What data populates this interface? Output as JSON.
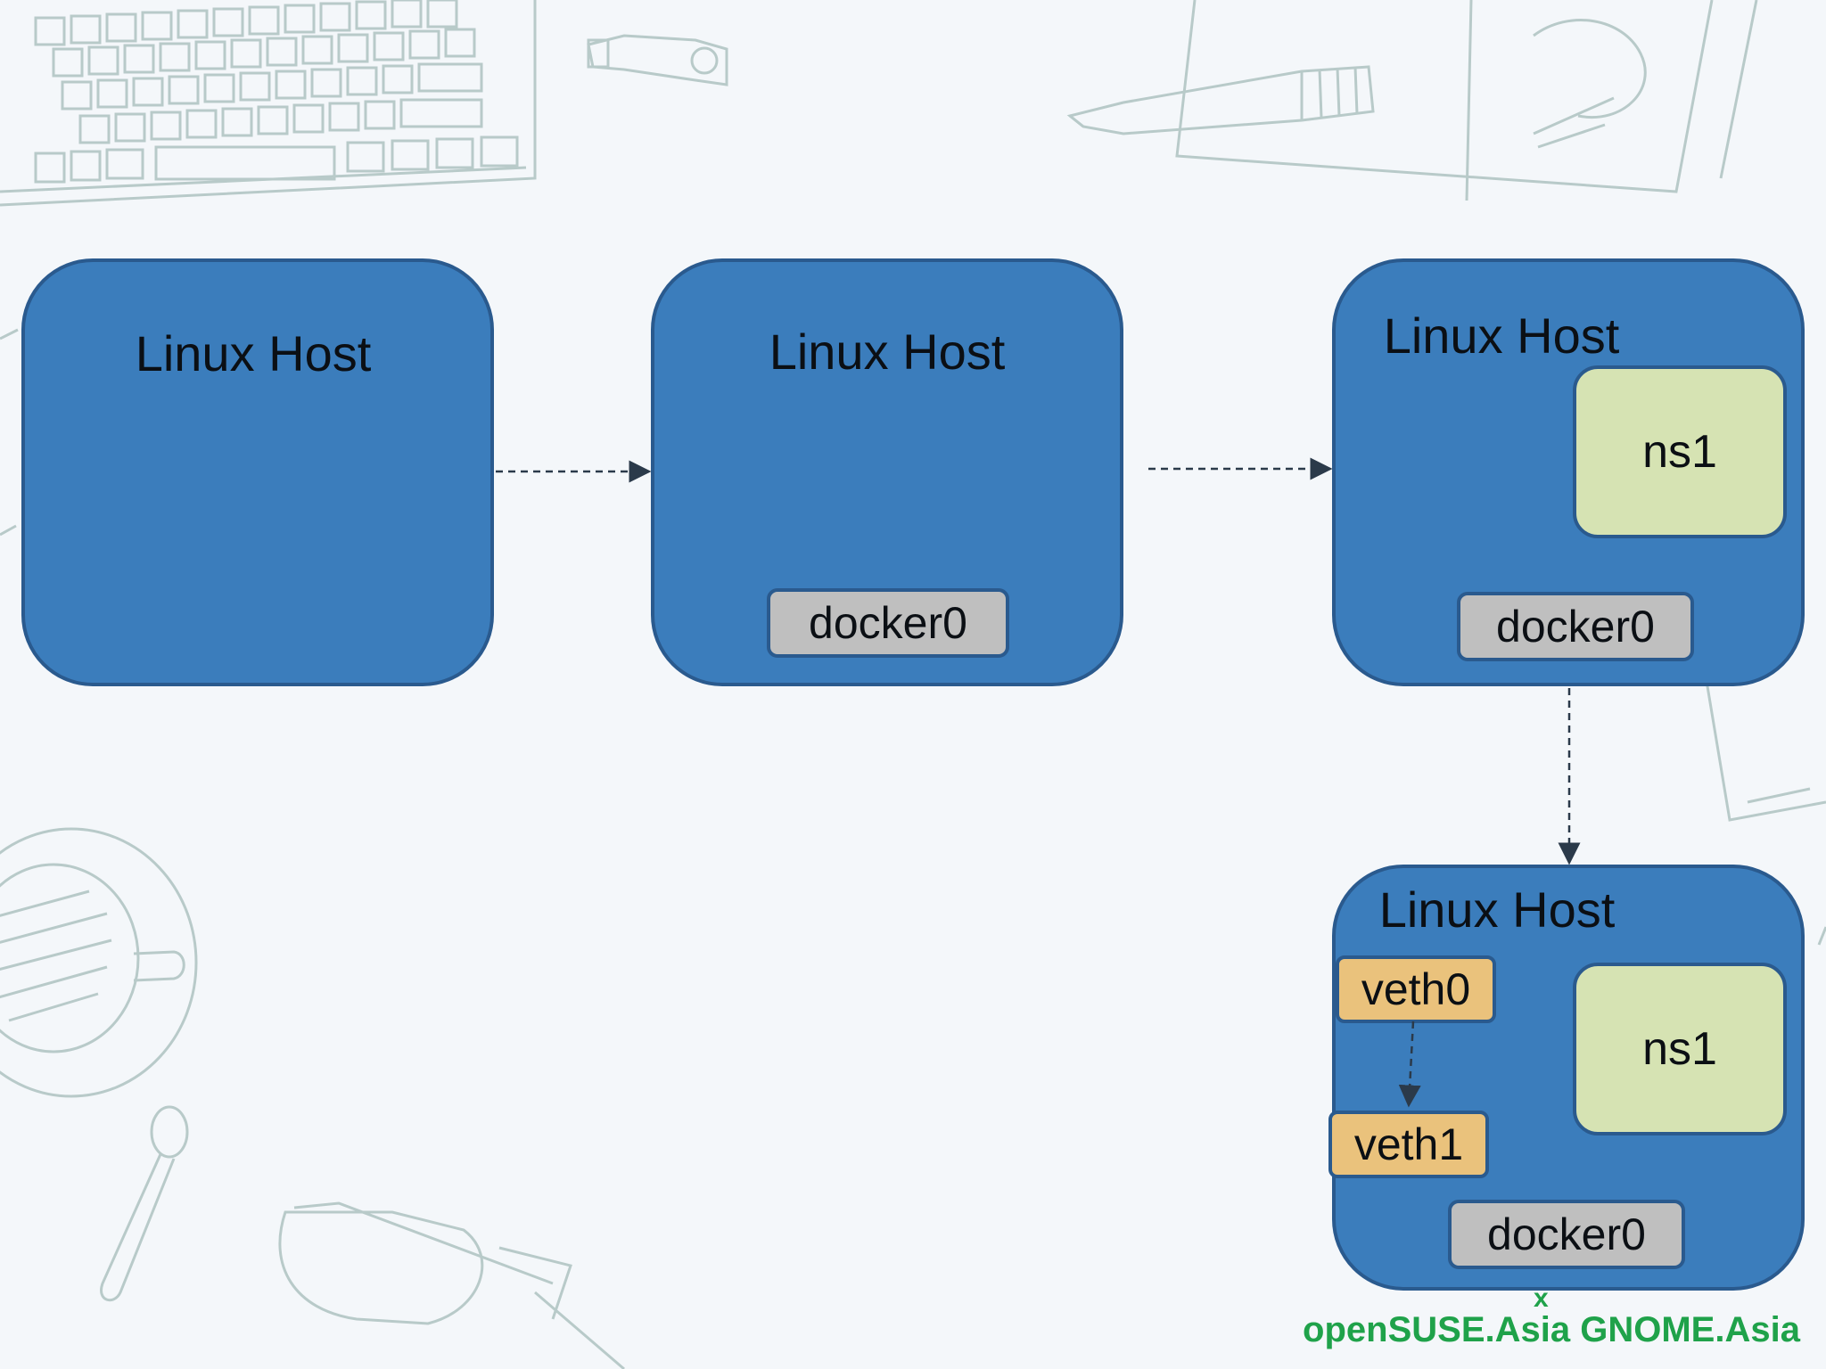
{
  "hosts": [
    {
      "label": "Linux Host"
    },
    {
      "label": "Linux Host",
      "bridge": "docker0"
    },
    {
      "label": "Linux Host",
      "bridge": "docker0",
      "namespace": "ns1"
    },
    {
      "label": "Linux Host",
      "bridge": "docker0",
      "namespace": "ns1",
      "veth_a": "veth0",
      "veth_b": "veth1"
    }
  ],
  "footer": {
    "text": "openSUSE.Asia GNOME.Asia",
    "mark": "x"
  },
  "colors": {
    "host_fill": "#3b7dbc",
    "host_border": "#2a5a8e",
    "bridge_fill": "#bfbfbf",
    "namespace_fill": "#d6e3b3",
    "veth_fill": "#eac27c",
    "arrow": "#2b3a4a",
    "footer_text": "#1fa24a",
    "sketch_lines": "#b8cac9"
  }
}
